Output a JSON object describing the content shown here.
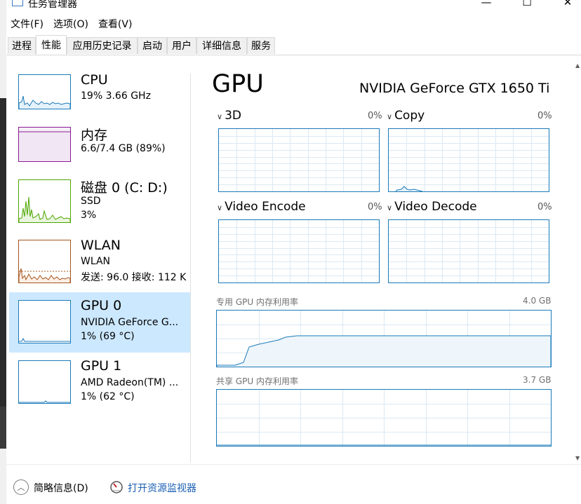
{
  "window": {
    "title": "任务管理器",
    "minimize_glyph": "—",
    "maximize_glyph": "☐",
    "close_glyph": "✕"
  },
  "menu": [
    "文件(F)",
    "选项(O)",
    "查看(V)"
  ],
  "tabs": [
    "进程",
    "性能",
    "应用历史记录",
    "启动",
    "用户",
    "详细信息",
    "服务"
  ],
  "active_tab": "性能",
  "sidebar": {
    "items": [
      {
        "name": "CPU",
        "line1": "19%  3.66 GHz",
        "line2": "",
        "color": "#1a7ab8"
      },
      {
        "name": "内存",
        "line1": "6.6/7.4 GB (89%)",
        "line2": "",
        "color": "#8b1a96"
      },
      {
        "name": "磁盘 0 (C: D:)",
        "line1": "SSD",
        "line2": "3%",
        "color": "#4da600"
      },
      {
        "name": "WLAN",
        "line1": "WLAN",
        "line2": "发送: 96.0  接收: 112 K",
        "color": "#a5541b"
      },
      {
        "name": "GPU 0",
        "line1": "NVIDIA GeForce G...",
        "line2": "1% (69 °C)",
        "color": "#1a7ab8"
      },
      {
        "name": "GPU 1",
        "line1": "AMD Radeon(TM) ...",
        "line2": "1% (62 °C)",
        "color": "#1a7ab8"
      }
    ],
    "selected_index": 4
  },
  "detail": {
    "title": "GPU",
    "model": "NVIDIA GeForce GTX 1650 Ti",
    "engines": [
      {
        "label": "3D",
        "percent": "0%"
      },
      {
        "label": "Copy",
        "percent": "0%"
      },
      {
        "label": "Video Encode",
        "percent": "0%"
      },
      {
        "label": "Video Decode",
        "percent": "0%"
      }
    ],
    "dedicated_label": "专用 GPU 内存利用率",
    "dedicated_max": "4.0 GB",
    "shared_label": "共享 GPU 内存利用率",
    "shared_max": "3.7 GB",
    "graph_color": "#1a7ab8",
    "fill_color": "#eef5fb"
  },
  "footer": {
    "fewer_details": "简略信息(D)",
    "resource_monitor": "打开资源监视器"
  }
}
